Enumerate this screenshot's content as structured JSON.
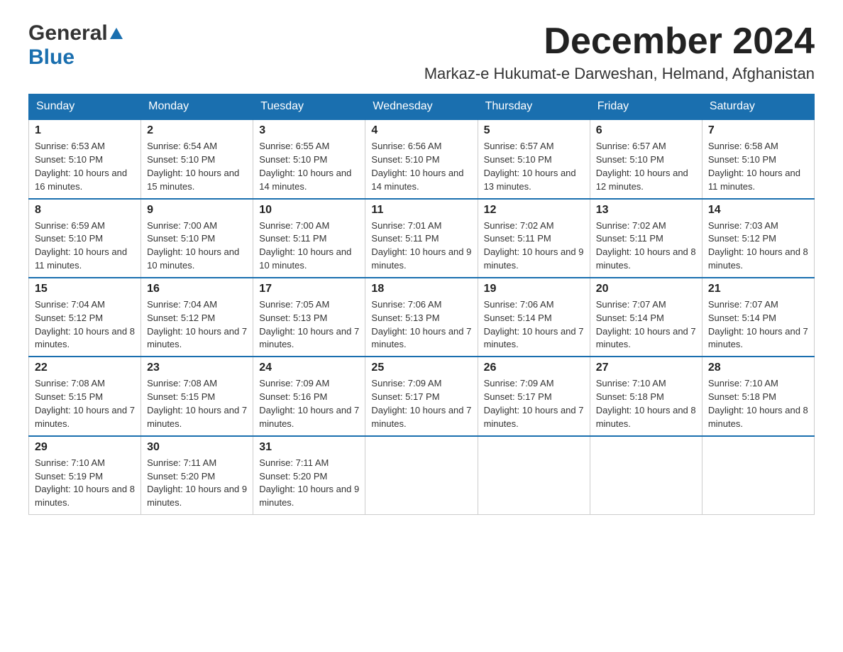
{
  "logo": {
    "general_text": "General",
    "blue_text": "Blue"
  },
  "header": {
    "month_title": "December 2024",
    "location": "Markaz-e Hukumat-e Darweshan, Helmand, Afghanistan"
  },
  "weekdays": [
    "Sunday",
    "Monday",
    "Tuesday",
    "Wednesday",
    "Thursday",
    "Friday",
    "Saturday"
  ],
  "weeks": [
    [
      {
        "day": "1",
        "sunrise": "6:53 AM",
        "sunset": "5:10 PM",
        "daylight": "10 hours and 16 minutes."
      },
      {
        "day": "2",
        "sunrise": "6:54 AM",
        "sunset": "5:10 PM",
        "daylight": "10 hours and 15 minutes."
      },
      {
        "day": "3",
        "sunrise": "6:55 AM",
        "sunset": "5:10 PM",
        "daylight": "10 hours and 14 minutes."
      },
      {
        "day": "4",
        "sunrise": "6:56 AM",
        "sunset": "5:10 PM",
        "daylight": "10 hours and 14 minutes."
      },
      {
        "day": "5",
        "sunrise": "6:57 AM",
        "sunset": "5:10 PM",
        "daylight": "10 hours and 13 minutes."
      },
      {
        "day": "6",
        "sunrise": "6:57 AM",
        "sunset": "5:10 PM",
        "daylight": "10 hours and 12 minutes."
      },
      {
        "day": "7",
        "sunrise": "6:58 AM",
        "sunset": "5:10 PM",
        "daylight": "10 hours and 11 minutes."
      }
    ],
    [
      {
        "day": "8",
        "sunrise": "6:59 AM",
        "sunset": "5:10 PM",
        "daylight": "10 hours and 11 minutes."
      },
      {
        "day": "9",
        "sunrise": "7:00 AM",
        "sunset": "5:10 PM",
        "daylight": "10 hours and 10 minutes."
      },
      {
        "day": "10",
        "sunrise": "7:00 AM",
        "sunset": "5:11 PM",
        "daylight": "10 hours and 10 minutes."
      },
      {
        "day": "11",
        "sunrise": "7:01 AM",
        "sunset": "5:11 PM",
        "daylight": "10 hours and 9 minutes."
      },
      {
        "day": "12",
        "sunrise": "7:02 AM",
        "sunset": "5:11 PM",
        "daylight": "10 hours and 9 minutes."
      },
      {
        "day": "13",
        "sunrise": "7:02 AM",
        "sunset": "5:11 PM",
        "daylight": "10 hours and 8 minutes."
      },
      {
        "day": "14",
        "sunrise": "7:03 AM",
        "sunset": "5:12 PM",
        "daylight": "10 hours and 8 minutes."
      }
    ],
    [
      {
        "day": "15",
        "sunrise": "7:04 AM",
        "sunset": "5:12 PM",
        "daylight": "10 hours and 8 minutes."
      },
      {
        "day": "16",
        "sunrise": "7:04 AM",
        "sunset": "5:12 PM",
        "daylight": "10 hours and 7 minutes."
      },
      {
        "day": "17",
        "sunrise": "7:05 AM",
        "sunset": "5:13 PM",
        "daylight": "10 hours and 7 minutes."
      },
      {
        "day": "18",
        "sunrise": "7:06 AM",
        "sunset": "5:13 PM",
        "daylight": "10 hours and 7 minutes."
      },
      {
        "day": "19",
        "sunrise": "7:06 AM",
        "sunset": "5:14 PM",
        "daylight": "10 hours and 7 minutes."
      },
      {
        "day": "20",
        "sunrise": "7:07 AM",
        "sunset": "5:14 PM",
        "daylight": "10 hours and 7 minutes."
      },
      {
        "day": "21",
        "sunrise": "7:07 AM",
        "sunset": "5:14 PM",
        "daylight": "10 hours and 7 minutes."
      }
    ],
    [
      {
        "day": "22",
        "sunrise": "7:08 AM",
        "sunset": "5:15 PM",
        "daylight": "10 hours and 7 minutes."
      },
      {
        "day": "23",
        "sunrise": "7:08 AM",
        "sunset": "5:15 PM",
        "daylight": "10 hours and 7 minutes."
      },
      {
        "day": "24",
        "sunrise": "7:09 AM",
        "sunset": "5:16 PM",
        "daylight": "10 hours and 7 minutes."
      },
      {
        "day": "25",
        "sunrise": "7:09 AM",
        "sunset": "5:17 PM",
        "daylight": "10 hours and 7 minutes."
      },
      {
        "day": "26",
        "sunrise": "7:09 AM",
        "sunset": "5:17 PM",
        "daylight": "10 hours and 7 minutes."
      },
      {
        "day": "27",
        "sunrise": "7:10 AM",
        "sunset": "5:18 PM",
        "daylight": "10 hours and 8 minutes."
      },
      {
        "day": "28",
        "sunrise": "7:10 AM",
        "sunset": "5:18 PM",
        "daylight": "10 hours and 8 minutes."
      }
    ],
    [
      {
        "day": "29",
        "sunrise": "7:10 AM",
        "sunset": "5:19 PM",
        "daylight": "10 hours and 8 minutes."
      },
      {
        "day": "30",
        "sunrise": "7:11 AM",
        "sunset": "5:20 PM",
        "daylight": "10 hours and 9 minutes."
      },
      {
        "day": "31",
        "sunrise": "7:11 AM",
        "sunset": "5:20 PM",
        "daylight": "10 hours and 9 minutes."
      },
      null,
      null,
      null,
      null
    ]
  ],
  "labels": {
    "sunrise": "Sunrise: ",
    "sunset": "Sunset: ",
    "daylight": "Daylight: "
  }
}
